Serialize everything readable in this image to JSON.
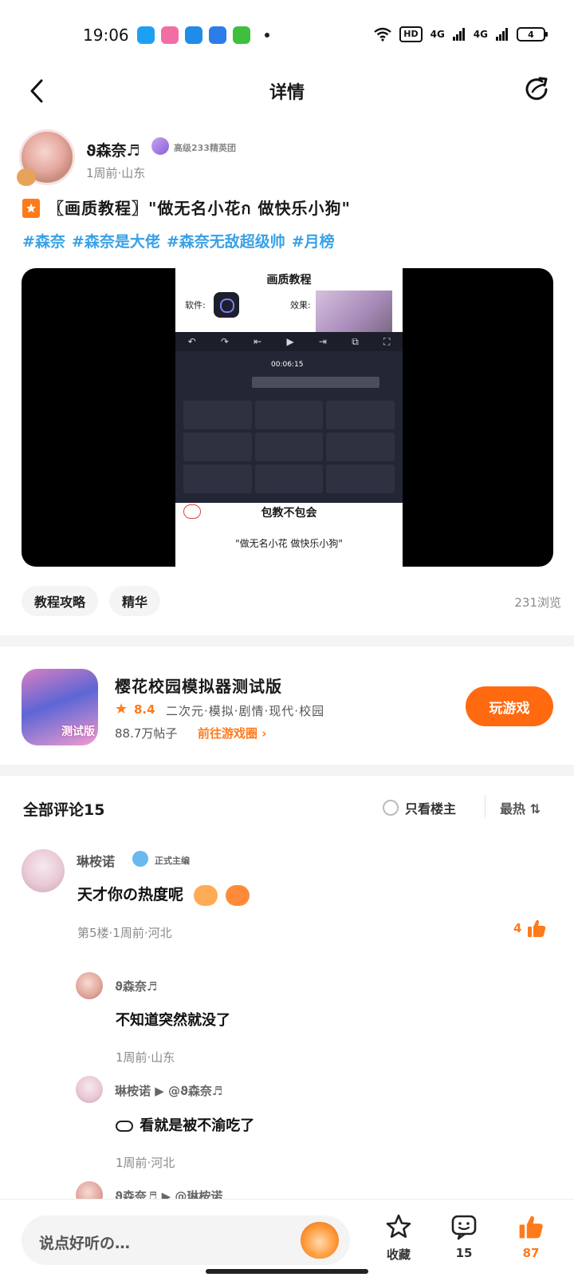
{
  "status_bar": {
    "time": "19:06",
    "hd_label": "HD",
    "net_1": "4G",
    "net_2": "4G",
    "battery": "4",
    "app_icons": [
      "qq-icon",
      "bilibili-icon",
      "calendar-icon",
      "feather-icon",
      "wechat-icon"
    ]
  },
  "header": {
    "title": "详情",
    "back_icon": "chevron-left-icon",
    "share_icon": "share-icon"
  },
  "author": {
    "name": "ϑ森奈♬",
    "rank": "高级233精英团",
    "meta": "1周前·山东"
  },
  "post": {
    "title": "〖画质教程〗\"做无名小花ก 做快乐小狗\"",
    "tags": [
      "#森奈",
      "#森奈是大佬",
      "#森奈无敌超级帅",
      "#月榜"
    ],
    "media": {
      "title": "画质教程",
      "software_label": "软件:",
      "effect_label": "效果:",
      "time_code": "00:06:15",
      "bottom_text": "包教不包会",
      "quote": "\"做无名小花 做快乐小狗\""
    },
    "chips": [
      "教程攻略",
      "精华"
    ],
    "views": "231浏览"
  },
  "game": {
    "icon_tag": "测试版",
    "name": "樱花校园模拟器测试版",
    "rating": "8.4",
    "genres": "二次元·模拟·剧情·现代·校园",
    "posts": "88.7万帖子",
    "link": "前往游戏圈",
    "play_label": "玩游戏"
  },
  "comments_header": {
    "title": "全部评论15",
    "only_op": "只看楼主",
    "sort": "最热"
  },
  "comment": {
    "name": "琳桉诺",
    "role": "正式主编",
    "text": "天才你の热度呢",
    "meta": "第5楼·1周前·河北",
    "likes": "4"
  },
  "replies": [
    {
      "name": "ϑ森奈♬",
      "text": "不知道突然就没了",
      "meta": "1周前·山东"
    },
    {
      "name": "琳桉诺 ▶ @ϑ森奈♬",
      "text": "看就是被不渝吃了",
      "meta": "1周前·河北"
    },
    {
      "name": "ϑ森奈♬ ▶ @琳桉诺"
    }
  ],
  "bottom_bar": {
    "placeholder": "说点好听の…",
    "favorite_label": "收藏",
    "comments_count": "15",
    "likes_count": "87"
  },
  "colors": {
    "accent": "#ff6a10",
    "tag_blue": "#3ba1e6",
    "meta_gray": "#8a8a8a"
  }
}
